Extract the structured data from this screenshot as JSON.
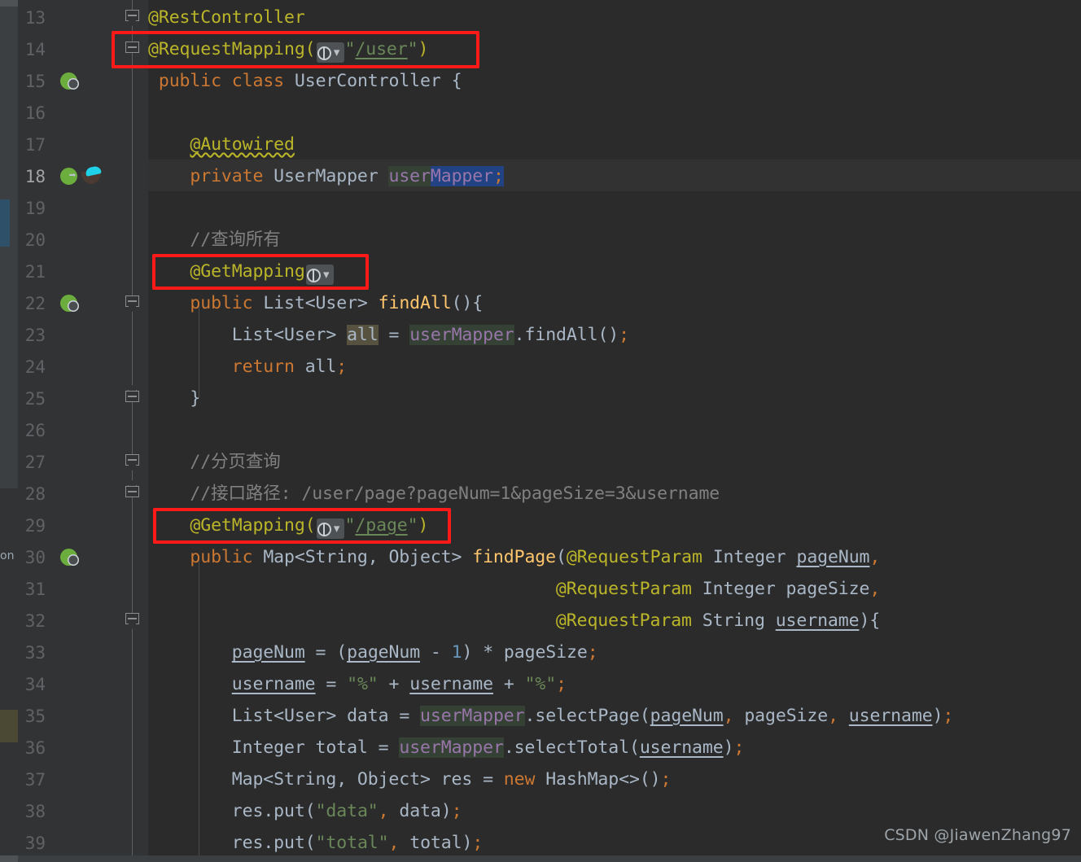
{
  "editor": {
    "app": "IntelliJ IDEA",
    "file_kind": "java-source",
    "theme": "darcula",
    "colors": {
      "background": "#2b2b2b",
      "gutter_background": "#313335",
      "line_number": "#606366",
      "current_line_number": "#a4a3a3",
      "keyword": "#cc7832",
      "annotation": "#bbb529",
      "string": "#6a8759",
      "number": "#6897bb",
      "comment": "#808080",
      "identifier": "#a9b7c6",
      "method": "#ffc66d",
      "field": "#9876aa",
      "selection": "#214283",
      "read_usage_highlight": "#344134",
      "write_usage_highlight": "#56523f",
      "annotation_box": "#ff1a1a"
    },
    "left_cut_text": "on",
    "watermark": "CSDN @JiawenZhang97",
    "current_line": 18,
    "first_visible_line": 13,
    "last_visible_line": 39
  },
  "lines": [
    {
      "n": "13",
      "icons": [],
      "fold": "fold-down"
    },
    {
      "n": "14",
      "icons": [],
      "fold": "fold-plain"
    },
    {
      "n": "15",
      "icons": [
        "spring-bean-globe-icon"
      ],
      "fold": ""
    },
    {
      "n": "16",
      "icons": [],
      "fold": ""
    },
    {
      "n": "17",
      "icons": [],
      "fold": ""
    },
    {
      "n": "18",
      "icons": [
        "spring-bean-arrow-icon",
        "mybatis-mapper-icon"
      ],
      "fold": ""
    },
    {
      "n": "19",
      "icons": [],
      "fold": ""
    },
    {
      "n": "20",
      "icons": [],
      "fold": ""
    },
    {
      "n": "21",
      "icons": [],
      "fold": ""
    },
    {
      "n": "22",
      "icons": [
        "spring-bean-globe-icon"
      ],
      "fold": "fold-down"
    },
    {
      "n": "23",
      "icons": [],
      "fold": ""
    },
    {
      "n": "24",
      "icons": [],
      "fold": ""
    },
    {
      "n": "25",
      "icons": [],
      "fold": "fold-up"
    },
    {
      "n": "26",
      "icons": [],
      "fold": ""
    },
    {
      "n": "27",
      "icons": [],
      "fold": "fold-down"
    },
    {
      "n": "28",
      "icons": [],
      "fold": "fold-up"
    },
    {
      "n": "29",
      "icons": [],
      "fold": ""
    },
    {
      "n": "30",
      "icons": [
        "spring-bean-globe-icon"
      ],
      "fold": ""
    },
    {
      "n": "31",
      "icons": [],
      "fold": ""
    },
    {
      "n": "32",
      "icons": [],
      "fold": "fold-down"
    },
    {
      "n": "33",
      "icons": [],
      "fold": ""
    },
    {
      "n": "34",
      "icons": [],
      "fold": ""
    },
    {
      "n": "35",
      "icons": [],
      "fold": ""
    },
    {
      "n": "36",
      "icons": [],
      "fold": ""
    },
    {
      "n": "37",
      "icons": [],
      "fold": ""
    },
    {
      "n": "38",
      "icons": [],
      "fold": ""
    },
    {
      "n": "39",
      "icons": [],
      "fold": ""
    }
  ],
  "code_text": {
    "l13": "@RestController",
    "l14": "@RequestMapping(\"/user\")",
    "l15": "public class UserController {",
    "l16": "",
    "l17": "    @Autowired",
    "l18": "    private UserMapper userMapper;",
    "l19": "",
    "l20": "    //查询所有",
    "l21": "    @GetMapping",
    "l22": "    public List<User> findAll(){",
    "l23": "        List<User> all = userMapper.findAll();",
    "l24": "        return all;",
    "l25": "    }",
    "l26": "",
    "l27": "    //分页查询",
    "l28": "    //接口路径: /user/page?pageNum=1&pageSize=3&username",
    "l29": "    @GetMapping(\"/page\")",
    "l30": "    public Map<String, Object> findPage(@RequestParam Integer pageNum,",
    "l31": "                                       @RequestParam Integer pageSize,",
    "l32": "                                       @RequestParam String username){",
    "l33": "        pageNum = (pageNum - 1) * pageSize;",
    "l34": "        username = \"%\" + username + \"%\";",
    "l35": "        List<User> data = userMapper.selectPage(pageNum, pageSize, username);",
    "l36": "        Integer total = userMapper.selectTotal(username);",
    "l37": "        Map<String, Object> res = new HashMap<>();",
    "l38": "        res.put(\"data\", data);",
    "l39": "        res.put(\"total\", total);"
  },
  "tokens": {
    "rest_controller": "@RestController",
    "request_mapping": "@RequestMapping",
    "get_mapping": "@GetMapping",
    "request_param": "@RequestParam",
    "autowired": "@Autowired",
    "path_user": "/user",
    "path_page": "/page",
    "kw_public": "public",
    "kw_class": "class",
    "kw_private": "private",
    "kw_return": "return",
    "kw_new": "new",
    "type_user_controller": "UserController",
    "type_user_mapper": "UserMapper",
    "type_list_user": "List<User>",
    "type_integer": "Integer",
    "type_string": "String",
    "type_object": "Object",
    "type_map_string_object": "Map<String, Object>",
    "type_hashmap": "HashMap<>",
    "field_user_mapper": "userMapper",
    "method_find_all": "findAll",
    "method_find_page": "findPage",
    "method_select_page": "selectPage",
    "method_select_total": "selectTotal",
    "method_put": "put",
    "var_all": "all",
    "var_data": "data",
    "var_total": "total",
    "var_res": "res",
    "var_page_num": "pageNum",
    "var_page_size": "pageSize",
    "var_username": "username",
    "comment_find_all": "//查询所有",
    "comment_paging": "//分页查询",
    "comment_api_path": "//接口路径: /user/page?pageNum=1&pageSize=3&username",
    "str_percent": "\"%\"",
    "str_data": "\"data\"",
    "str_total": "\"total\"",
    "num_one": "1"
  },
  "annotations": {
    "boxes": [
      {
        "label": "request-mapping-user-highlight",
        "target": "@RequestMapping(\"/user\")"
      },
      {
        "label": "get-mapping-findall-highlight",
        "target": "@GetMapping"
      },
      {
        "label": "get-mapping-page-highlight",
        "target": "@GetMapping(\"/page\")"
      }
    ]
  },
  "inline_hints": {
    "globe_label": "web-endpoint-gutter-hint",
    "chevron": "⌄"
  }
}
